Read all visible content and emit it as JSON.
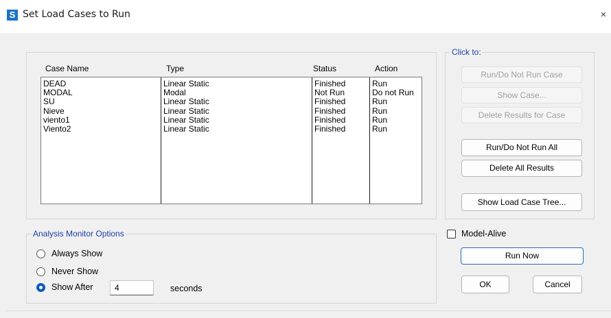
{
  "window": {
    "title": "Set Load Cases to Run",
    "app_icon_letter": "S",
    "close_glyph": "×"
  },
  "cases_table": {
    "headers": [
      "Case Name",
      "Type",
      "Status",
      "Action"
    ],
    "rows": [
      [
        "DEAD",
        "Linear Static",
        "Finished",
        "Run"
      ],
      [
        "MODAL",
        "Modal",
        "Not Run",
        "Do not Run"
      ],
      [
        "SU",
        "Linear Static",
        "Finished",
        "Run"
      ],
      [
        "Nieve",
        "Linear Static",
        "Finished",
        "Run"
      ],
      [
        "viento1",
        "Linear Static",
        "Finished",
        "Run"
      ],
      [
        "Viento2",
        "Linear Static",
        "Finished",
        "Run"
      ]
    ]
  },
  "click_to": {
    "label": "Click to:",
    "run_do_not_run_case": "Run/Do Not Run Case",
    "show_case": "Show Case...",
    "delete_results_for_case": "Delete Results for Case",
    "run_do_not_run_all": "Run/Do Not Run All",
    "delete_all_results": "Delete All Results",
    "show_load_case_tree": "Show Load Case Tree..."
  },
  "monitor": {
    "label": "Analysis Monitor Options",
    "always_show": "Always Show",
    "never_show": "Never Show",
    "show_after": "Show After",
    "show_after_value": "4",
    "seconds": "seconds",
    "selected": "show_after"
  },
  "model_alive": {
    "label": "Model-Alive",
    "checked": false
  },
  "buttons": {
    "run_now": "Run Now",
    "ok": "OK",
    "cancel": "Cancel"
  },
  "colors": {
    "accent": "#0a5cbf",
    "group_label": "#1f3fa8",
    "app_icon": "#1c73c8"
  }
}
